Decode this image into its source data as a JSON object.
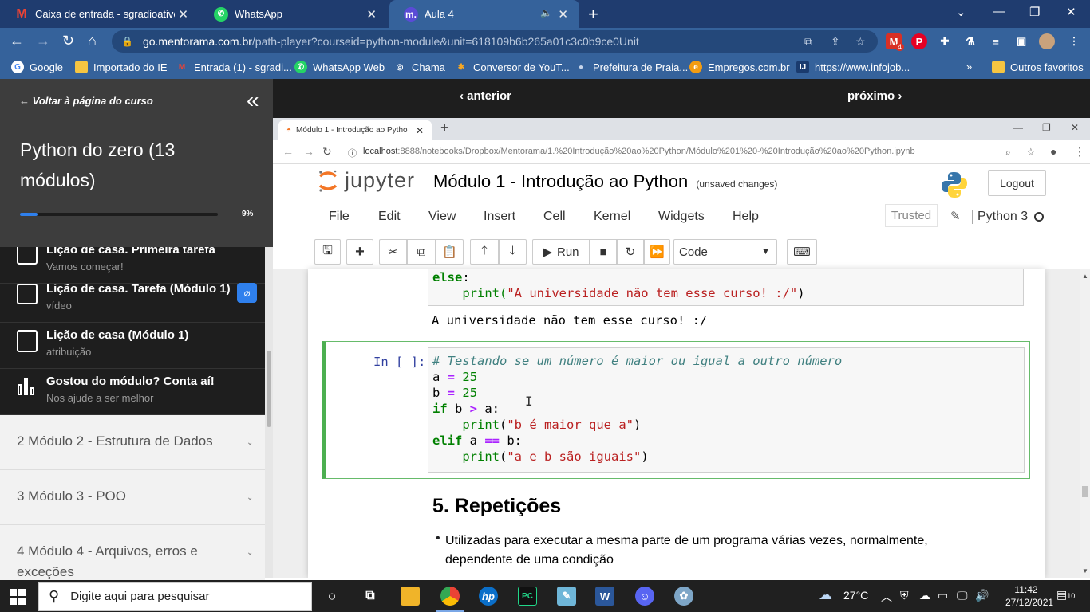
{
  "tabs": [
    {
      "title": "Caixa de entrada - sgradioativo@",
      "icon": "gmail-icon"
    },
    {
      "title": "WhatsApp",
      "icon": "whatsapp-icon"
    },
    {
      "title": "Aula 4",
      "icon": "mentorama-icon"
    }
  ],
  "address": {
    "domain": "go.mentorama.com.br",
    "path": "/path-player?courseid=python-module&unit=618109b6b265a01c3c0b9ce0Unit"
  },
  "extension_badge": "4",
  "bookmarks": [
    "Google",
    "Importado do IE",
    "Entrada (1) - sgradi...",
    "WhatsApp Web",
    "Chama",
    "Conversor de YouT...",
    "Prefeitura de Praia...",
    "Empregos.com.br",
    "https://www.infojob..."
  ],
  "bookmarks_more": "»",
  "bookmarks_other": "Outros favoritos",
  "sidebar": {
    "back_label": "Voltar à página do curso",
    "course_title": "Python do zero (13 módulos)",
    "progress_value": 0.09,
    "progress_label": "9%",
    "lessons": [
      {
        "title": "Lição de casa. Primeira tarefa",
        "sub": "Vamos começar!"
      },
      {
        "title": "Lição de casa. Tarefa (Módulo 1)",
        "sub": "vídeo"
      },
      {
        "title": "Lição de casa (Módulo 1)",
        "sub": "atribuição"
      },
      {
        "title": "Gostou do módulo? Conta aí!",
        "sub": "Nos ajude a ser melhor"
      }
    ],
    "modules": [
      "2 Módulo 2 - Estrutura de Dados",
      "3 Módulo 3 - POO",
      "4 Módulo 4 - Arquivos, erros e exceções"
    ]
  },
  "player_nav": {
    "prev": "anterior",
    "next": "próximo"
  },
  "inner_browser": {
    "tab_title": "Módulo 1 - Introdução ao Pytho",
    "url_host": "localhost",
    "url_path": ":8888/notebooks/Dropbox/Mentorama/1.%20Introdução%20ao%20Python/Módulo%201%20-%20Introdução%20ao%20Python.ipynb"
  },
  "jupyter": {
    "logo_text": "jupyter",
    "notebook_title": "Módulo 1 - Introdução ao Python",
    "save_status": "(unsaved changes)",
    "logout": "Logout",
    "menu": [
      "File",
      "Edit",
      "View",
      "Insert",
      "Cell",
      "Kernel",
      "Widgets",
      "Help"
    ],
    "trusted": "Trusted",
    "kernel": "Python 3",
    "run_label": "Run",
    "cell_type": "Code"
  },
  "notebook": {
    "prev_cell_line1_kw": "else",
    "prev_cell_line2_fn": "print(",
    "prev_cell_line2_str": "\"A universidade não tem esse curso! :/\"",
    "prev_output": "A universidade não tem esse curso! :/",
    "in_prompt": "In [ ]:",
    "code_comment": "# Testando se um número é maior ou igual a outro número",
    "code_a": "25",
    "code_b": "25",
    "code_str1": "\"b é maior que a\"",
    "code_str2": "\"a e b são iguais\"",
    "heading": "5. Repetições",
    "bullet": "Utilizadas para executar a mesma parte de um programa várias vezes, normalmente, dependente de uma condição"
  },
  "taskbar": {
    "search_placeholder": "Digite aqui para pesquisar",
    "temperature": "27°C",
    "time": "11:42",
    "date": "27/12/2021",
    "notifications": "10"
  }
}
